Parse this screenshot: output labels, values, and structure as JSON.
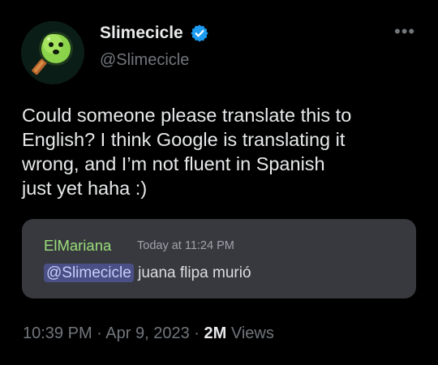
{
  "author": {
    "display_name": "Slimecicle",
    "handle": "@Slimecicle",
    "verified": true,
    "avatar_icon": "green-slime-lollipop-icon"
  },
  "tweet": {
    "text_lines": [
      "Could someone please translate this to",
      "English? I think Google is translating it",
      "wrong, and I’m not fluent in Spanish",
      "just yet haha :)"
    ]
  },
  "embedded_message": {
    "author": "ElMariana",
    "timestamp": "Today at 11:24 PM",
    "mention": "@Slimecicle",
    "body": "juana flipa murió"
  },
  "meta": {
    "time": "10:39 PM",
    "date": "Apr 9, 2023",
    "views_count": "2M",
    "views_label": "Views",
    "separator": "·"
  },
  "icons": {
    "more": "more-options-icon",
    "verified": "verified-badge-icon"
  },
  "colors": {
    "background": "#000000",
    "text_primary": "#e7e9ea",
    "text_secondary": "#71767b",
    "verified_blue": "#1d9bf0",
    "embed_background": "#37393e",
    "embed_author": "#9bde7b",
    "mention_bg": "#4a4f85"
  }
}
